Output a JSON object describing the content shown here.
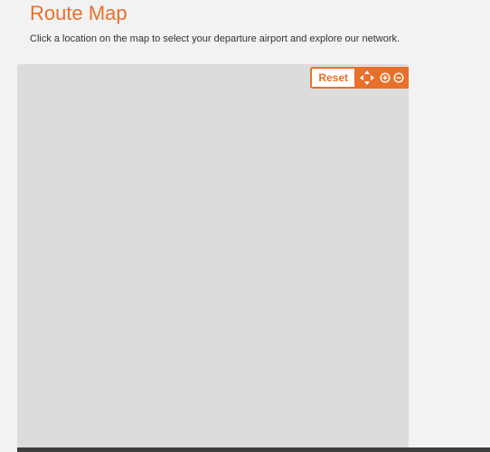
{
  "page": {
    "title": "Route Map",
    "intro": "Click a location on the map to select your departure airport and explore our network."
  },
  "map": {
    "controls": {
      "reset_label": "Reset",
      "icons": [
        "pan-arrows-icon",
        "zoom-in-icon",
        "zoom-out-icon"
      ]
    }
  },
  "colors": {
    "accent": "#e8702a",
    "map_background": "#dcdcdc",
    "page_background": "#f2f2f2"
  }
}
